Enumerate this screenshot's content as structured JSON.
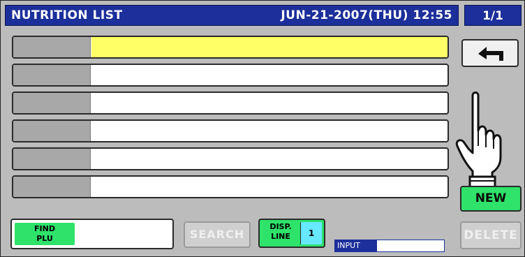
{
  "header": {
    "title": "NUTRITION LIST",
    "datetime": "JUN-21-2007(THU) 12:55",
    "page": "1/1"
  },
  "list": {
    "rows": [
      {
        "code": "",
        "name": ""
      },
      {
        "code": "",
        "name": ""
      },
      {
        "code": "",
        "name": ""
      },
      {
        "code": "",
        "name": ""
      },
      {
        "code": "",
        "name": ""
      },
      {
        "code": "",
        "name": ""
      }
    ],
    "selected_index": 0
  },
  "buttons": {
    "back_icon": "return-arrow-icon",
    "new_label": "NEW",
    "delete_label": "DELETE",
    "search_label": "SEARCH"
  },
  "find_plu": {
    "label": "FIND\nPLU",
    "value": ""
  },
  "disp_line": {
    "label": "DISP.\nLINE",
    "value": "1"
  },
  "input_indicator": {
    "label": "INPUT",
    "value": ""
  },
  "colors": {
    "header_bg": "#1c2f9a",
    "selected_row": "#ffff66",
    "green_button": "#2ee26a",
    "cyan_value": "#66e8ff"
  },
  "icons": {
    "pointer": "hand-pointer-icon"
  }
}
